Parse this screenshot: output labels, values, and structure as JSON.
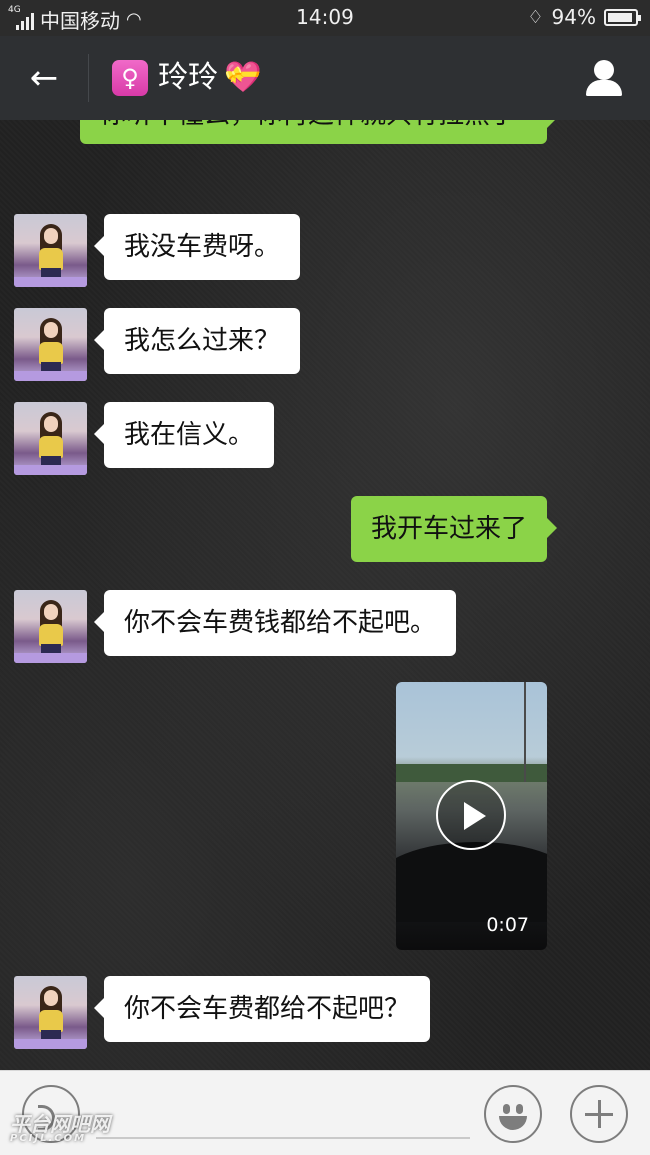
{
  "status_bar": {
    "network": "4G",
    "carrier": "中国移动",
    "time": "14:09",
    "battery": "94%",
    "battery_level": 0.94
  },
  "header": {
    "back_icon": "arrow-left-icon",
    "contact_name": "玲玲",
    "contact_badge_icon": "female-icon",
    "name_suffix_icon": "heart-gift-icon",
    "profile_icon": "person-icon"
  },
  "messages": [
    {
      "from": "me",
      "type": "text",
      "text": "你听不懂么，你再这样就只有拉黑了"
    },
    {
      "from": "contact",
      "type": "text",
      "text": "我没车费呀。"
    },
    {
      "from": "contact",
      "type": "text",
      "text": "我怎么过来？"
    },
    {
      "from": "contact",
      "type": "text",
      "text": "我在信义。"
    },
    {
      "from": "me",
      "type": "text",
      "text": "我开车过来了"
    },
    {
      "from": "contact",
      "type": "text",
      "text": "你不会车费钱都给不起吧。"
    },
    {
      "from": "me",
      "type": "video",
      "duration": "0:07"
    },
    {
      "from": "contact",
      "type": "text",
      "text": "你不会车费都给不起吧？"
    }
  ],
  "input_bar": {
    "voice_icon": "voice-icon",
    "emoji_icon": "smiley-icon",
    "plus_icon": "plus-icon"
  },
  "watermark": {
    "line1": "平台网吧网",
    "line2": "PCIJL.COM"
  }
}
